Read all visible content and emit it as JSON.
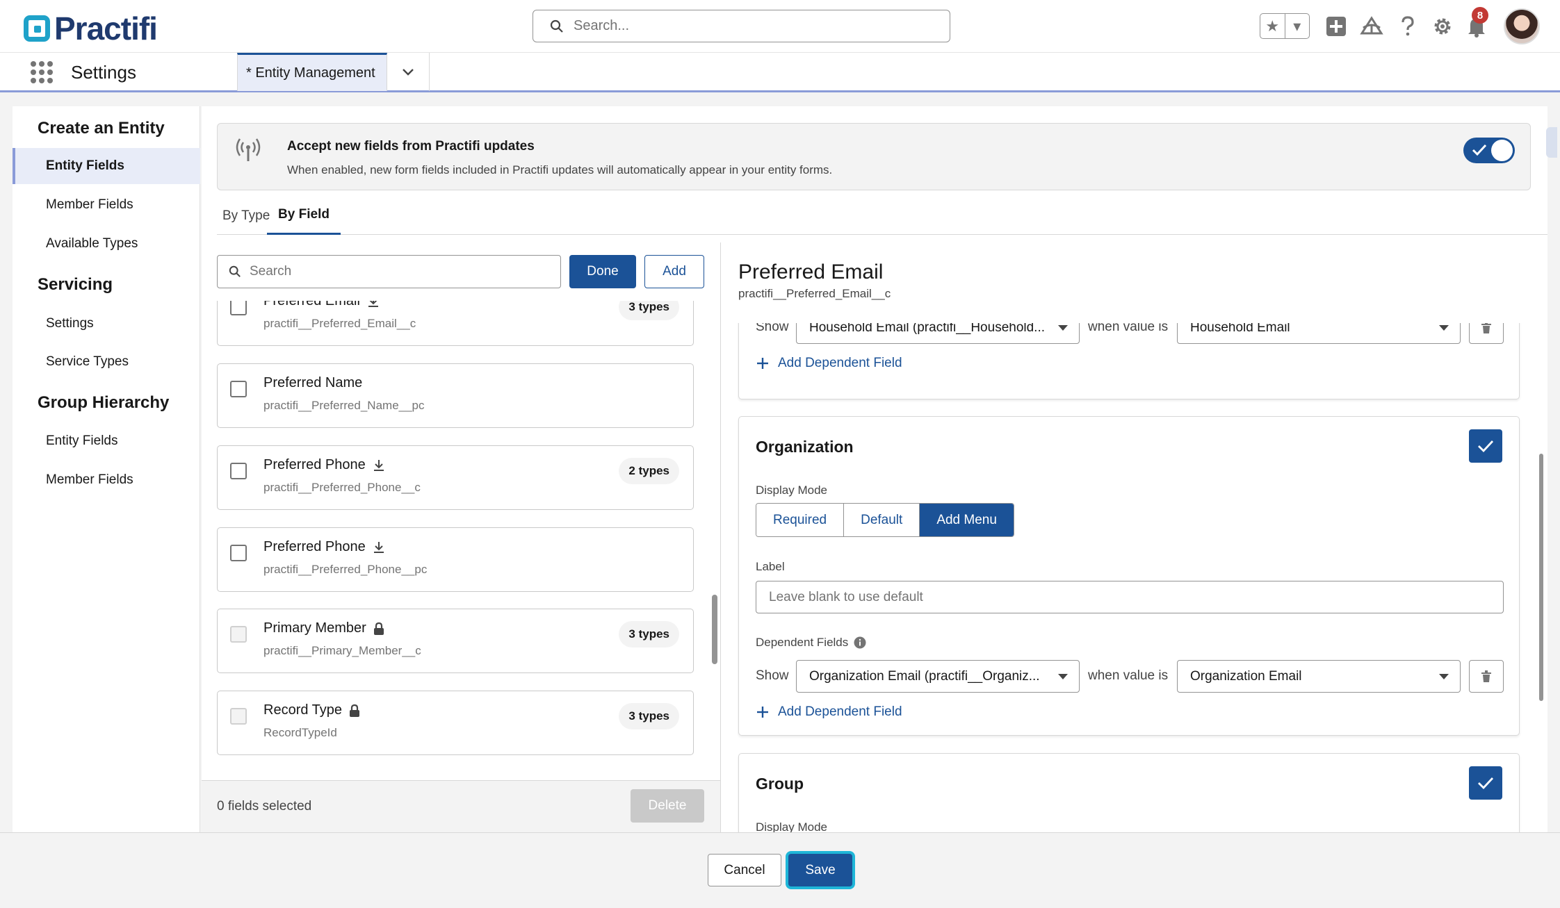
{
  "header": {
    "logo_text": "Practifi",
    "search_placeholder": "Search...",
    "notification_count": "8"
  },
  "appbar": {
    "app_name": "Settings",
    "tab_label": "* Entity Management"
  },
  "sidebar": {
    "sections": [
      {
        "title": "Create an Entity",
        "items": [
          "Entity Fields",
          "Member Fields",
          "Available Types"
        ]
      },
      {
        "title": "Servicing",
        "items": [
          "Settings",
          "Service Types"
        ]
      },
      {
        "title": "Group Hierarchy",
        "items": [
          "Entity Fields",
          "Member Fields"
        ]
      }
    ],
    "active_item": "Entity Fields"
  },
  "banner": {
    "title": "Accept new fields from Practifi updates",
    "description": "When enabled, new form fields included in Practifi updates will automatically appear in your entity forms.",
    "enabled": true
  },
  "tabs": [
    {
      "label": "By Type",
      "selected": false
    },
    {
      "label": "By Field",
      "selected": true
    }
  ],
  "field_list": {
    "search_placeholder": "Search",
    "done_label": "Done",
    "add_label": "Add",
    "fields": [
      {
        "name": "Preferred Email",
        "api": "practifi__Preferred_Email__c",
        "types": "3 types",
        "icon": "download-icon",
        "checkbox_disabled": false
      },
      {
        "name": "Preferred Name",
        "api": "practifi__Preferred_Name__pc",
        "types": "",
        "icon": "",
        "checkbox_disabled": false
      },
      {
        "name": "Preferred Phone",
        "api": "practifi__Preferred_Phone__c",
        "types": "2 types",
        "icon": "download-icon",
        "checkbox_disabled": false
      },
      {
        "name": "Preferred Phone",
        "api": "practifi__Preferred_Phone__pc",
        "types": "",
        "icon": "download-icon",
        "checkbox_disabled": false
      },
      {
        "name": "Primary Member",
        "api": "practifi__Primary_Member__c",
        "types": "3 types",
        "icon": "lock-icon",
        "checkbox_disabled": true
      },
      {
        "name": "Record Type",
        "api": "RecordTypeId",
        "types": "3 types",
        "icon": "lock-icon",
        "checkbox_disabled": true
      }
    ],
    "selected_count": "0 fields selected",
    "delete_label": "Delete"
  },
  "detail": {
    "title": "Preferred Email",
    "api_name": "practifi__Preferred_Email__c",
    "household_partial": {
      "show_label": "Show",
      "field_value": "Household Email (practifi__Household...",
      "when_label": "when value is",
      "value": "Household Email",
      "add_dependent_label": "Add Dependent Field"
    },
    "organization": {
      "title": "Organization",
      "display_mode_label": "Display Mode",
      "modes": [
        "Required",
        "Default",
        "Add Menu"
      ],
      "selected_mode": "Add Menu",
      "label_label": "Label",
      "label_placeholder": "Leave blank to use default",
      "dependent_fields_label": "Dependent Fields",
      "show_label": "Show",
      "field_value": "Organization Email (practifi__Organiz...",
      "when_label": "when value is",
      "value": "Organization Email",
      "add_dependent_label": "Add Dependent Field"
    },
    "group": {
      "title": "Group",
      "display_mode_label": "Display Mode"
    }
  },
  "footer": {
    "cancel_label": "Cancel",
    "save_label": "Save"
  }
}
